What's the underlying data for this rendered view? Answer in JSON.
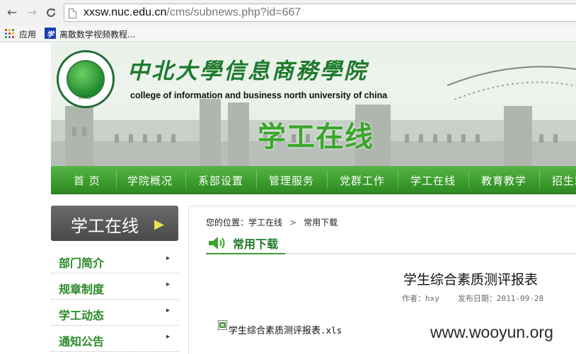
{
  "browser": {
    "back_icon": "arrow-left-icon",
    "forward_icon": "arrow-right-icon",
    "reload_icon": "reload-icon",
    "url_host": "xxsw.nuc.edu.cn",
    "url_path": "/cms/subnews.php?id=667",
    "bookmarks": [
      {
        "label": "应用",
        "icon": "apps-grid-icon"
      },
      {
        "label": "离散数学视频教程...",
        "icon": "bookmark-favicon"
      }
    ]
  },
  "banner": {
    "school_name_cn": "中北大學信息商務學院",
    "school_name_en": "college of information and business north university of china",
    "logo_year": "2003",
    "section_title": "学工在线"
  },
  "nav": {
    "items": [
      "首 页",
      "学院概况",
      "系部设置",
      "管理服务",
      "党群工作",
      "学工在线",
      "教育教学",
      "招生就"
    ]
  },
  "sidebar": {
    "title": "学工在线",
    "items": [
      {
        "label": "部门简介"
      },
      {
        "label": "规章制度"
      },
      {
        "label": "学工动态"
      },
      {
        "label": "通知公告"
      }
    ]
  },
  "content": {
    "breadcrumb_prefix": "您的位置：",
    "breadcrumb_section": "学工在线",
    "breadcrumb_sep": ">",
    "breadcrumb_current": "常用下载",
    "category_title": "常用下载",
    "article_title": "学生综合素质测评报表",
    "author_label": "作者：",
    "author": "hxy",
    "date_label": "发布日期：",
    "date": "2011-09-28",
    "attachment_name": "学生综合素质测评报表",
    "attachment_ext": ".xls"
  },
  "watermark": "www.wooyun.org",
  "colors": {
    "brand_green": "#3d9e2e",
    "sidebar_label_green": "#2a8a2a",
    "sidebar_header_gray": "#4a4a4a"
  }
}
